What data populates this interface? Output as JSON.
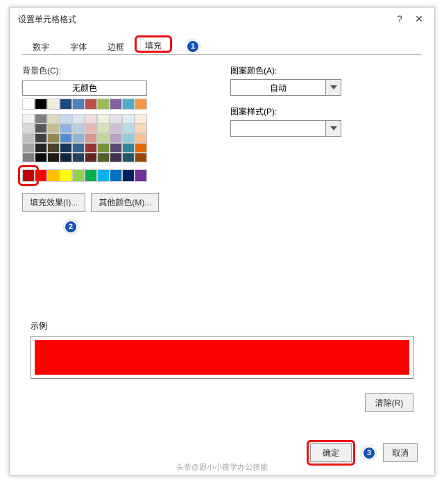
{
  "title": "设置单元格格式",
  "help_symbol": "?",
  "close_symbol": "✕",
  "tabs": {
    "number": "数字",
    "font": "字体",
    "border": "边框",
    "fill": "填充"
  },
  "badges": {
    "one": "1",
    "two": "2",
    "three": "3"
  },
  "left": {
    "bgcolor_label": "背景色(C):",
    "nocolor_label": "无颜色",
    "fill_effects_btn": "填充效果(I)...",
    "more_colors_btn": "其他颜色(M)..."
  },
  "right": {
    "pattern_color_label": "图案颜色(A):",
    "pattern_color_value": "自动",
    "pattern_style_label": "图案样式(P):",
    "pattern_style_value": ""
  },
  "sample_label": "示例",
  "sample_color": "#ff0000",
  "clear_btn": "清除(R)",
  "ok_btn": "确定",
  "cancel_btn": "取消",
  "watermark": "头条@跟小小筱学办公技能",
  "theme_row1": [
    "#ffffff",
    "#000000",
    "#eeece1",
    "#1f497d",
    "#4f81bd",
    "#c0504d",
    "#9bbb59",
    "#8064a2",
    "#4bacc6",
    "#f79646"
  ],
  "theme_shades": [
    [
      "#f2f2f2",
      "#7f7f7f",
      "#ddd9c3",
      "#c6d9f0",
      "#dbe5f1",
      "#f2dcdb",
      "#ebf1dd",
      "#e5e0ec",
      "#dbeef3",
      "#fdeada"
    ],
    [
      "#d8d8d8",
      "#595959",
      "#c4bd97",
      "#8db3e2",
      "#b8cce4",
      "#e5b9b7",
      "#d7e3bc",
      "#ccc1d9",
      "#b7dde8",
      "#fbd5b5"
    ],
    [
      "#bfbfbf",
      "#404040",
      "#938953",
      "#548dd4",
      "#95b3d7",
      "#d99694",
      "#c3d69b",
      "#b2a2c7",
      "#92cddc",
      "#fac08f"
    ],
    [
      "#a5a5a5",
      "#262626",
      "#494429",
      "#17365d",
      "#366092",
      "#953734",
      "#76923c",
      "#5f497a",
      "#31859b",
      "#e36c09"
    ],
    [
      "#7f7f7f",
      "#0c0c0c",
      "#1d1b10",
      "#0f243e",
      "#244061",
      "#632423",
      "#4f6128",
      "#3f3151",
      "#205867",
      "#974806"
    ]
  ],
  "standard_colors": [
    "#c00000",
    "#ff0000",
    "#ffc000",
    "#ffff00",
    "#92d050",
    "#00b050",
    "#00b0f0",
    "#0070c0",
    "#002060",
    "#7030a0"
  ]
}
